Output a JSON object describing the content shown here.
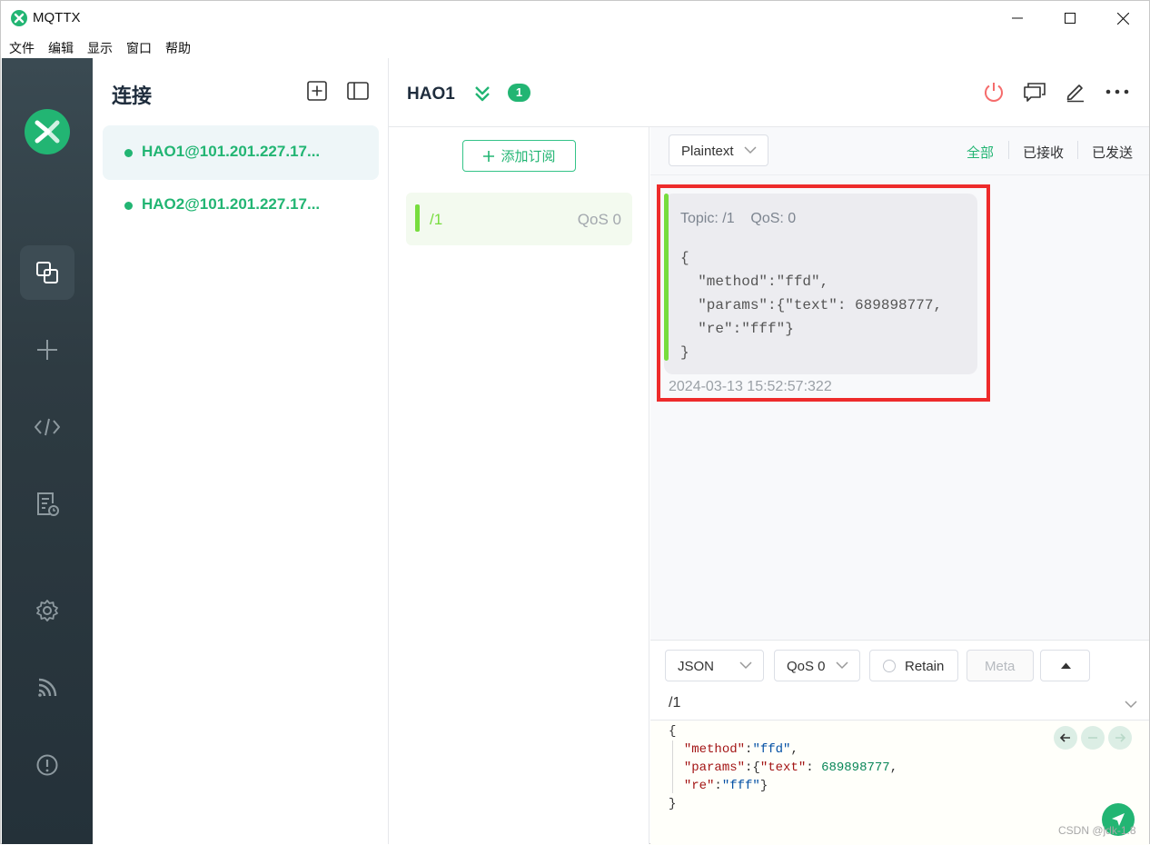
{
  "window": {
    "title": "MQTTX"
  },
  "menu": [
    "文件",
    "编辑",
    "显示",
    "窗口",
    "帮助"
  ],
  "sidebar": {
    "nav": [
      "connections-icon",
      "add-icon",
      "script-icon",
      "log-icon",
      "settings-icon",
      "feed-icon",
      "about-icon"
    ]
  },
  "connections": {
    "title": "连接",
    "items": [
      {
        "name": "HAO1@101.201.227.17...",
        "status": "connected"
      },
      {
        "name": "HAO2@101.201.227.17...",
        "status": "connected"
      }
    ]
  },
  "header": {
    "name": "HAO1",
    "badge": "1"
  },
  "subscriptions": {
    "add_label": "添加订阅",
    "items": [
      {
        "topic": "/1",
        "qos": "QoS 0"
      }
    ]
  },
  "messages": {
    "format": "Plaintext",
    "filters": [
      "全部",
      "已接收",
      "已发送"
    ],
    "active_filter": "全部",
    "items": [
      {
        "topic_label": "Topic: /1",
        "qos_label": "QoS: 0",
        "payload_lines": [
          "{",
          "  \"method\":\"ffd\",",
          "  \"params\":{\"text\": 689898777,",
          "  \"re\":\"fff\"}",
          "}"
        ],
        "time": "2024-03-13 15:52:57:322"
      }
    ]
  },
  "publish": {
    "payload_format": "JSON",
    "qos": "QoS 0",
    "retain_label": "Retain",
    "meta_label": "Meta",
    "topic": "/1"
  },
  "watermark": "CSDN @jdk-1.8",
  "colors": {
    "accent": "#22b573",
    "highlight": "#ee2b2b",
    "topic": "#77dd3d"
  }
}
